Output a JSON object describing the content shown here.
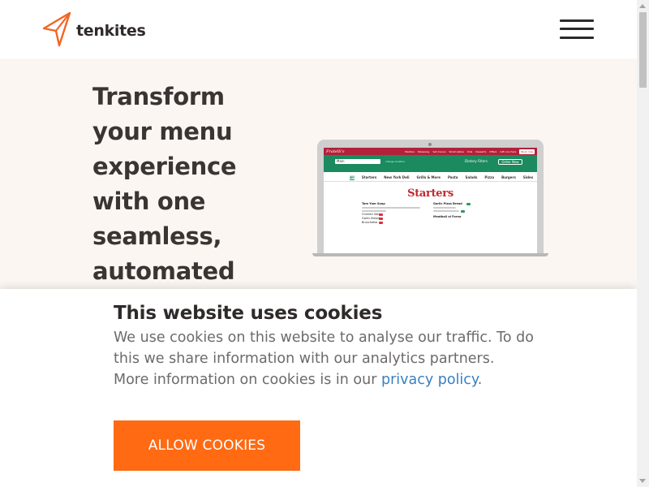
{
  "brand": {
    "name": "tenkites",
    "accent": "#f26522"
  },
  "header": {
    "menu_icon": "hamburger-icon"
  },
  "hero": {
    "title": "Transform your menu experience with one seamless, automated",
    "mockup": {
      "logo": "Fratelli's",
      "nav_links": [
        "Starters",
        "Takeaway",
        "Set menus",
        "Small plates",
        "Kids",
        "Desserts",
        "Offers",
        "Gift vouchers"
      ],
      "book_label": "Book now",
      "select_value": "Main",
      "select_note": "change location",
      "filter_label": "Dietary Filters",
      "order_label": "Order Now",
      "tabs": [
        "All",
        "Starters",
        "New York Deli",
        "Grills & More",
        "Pasta",
        "Salads",
        "Pizza",
        "Burgers",
        "Sides"
      ],
      "section_heading": "Starters",
      "items_left": [
        "Tom Yum Soup",
        "Chicken Satay",
        "Garlic Bread",
        "Bruschetta"
      ],
      "items_right": [
        "Garlic Pizza Bread",
        "Meatball al Forno"
      ]
    }
  },
  "cookie": {
    "title": "This website uses cookies",
    "body": "We use cookies on this website to analyse our traffic. To do this we share information with our analytics partners.",
    "more_prefix": "More information on cookies is in our ",
    "link_text": "privacy policy",
    "more_suffix": ".",
    "button_label": "ALLOW COOKIES",
    "button_color": "#ff6a13",
    "link_color": "#3a7fc2"
  }
}
